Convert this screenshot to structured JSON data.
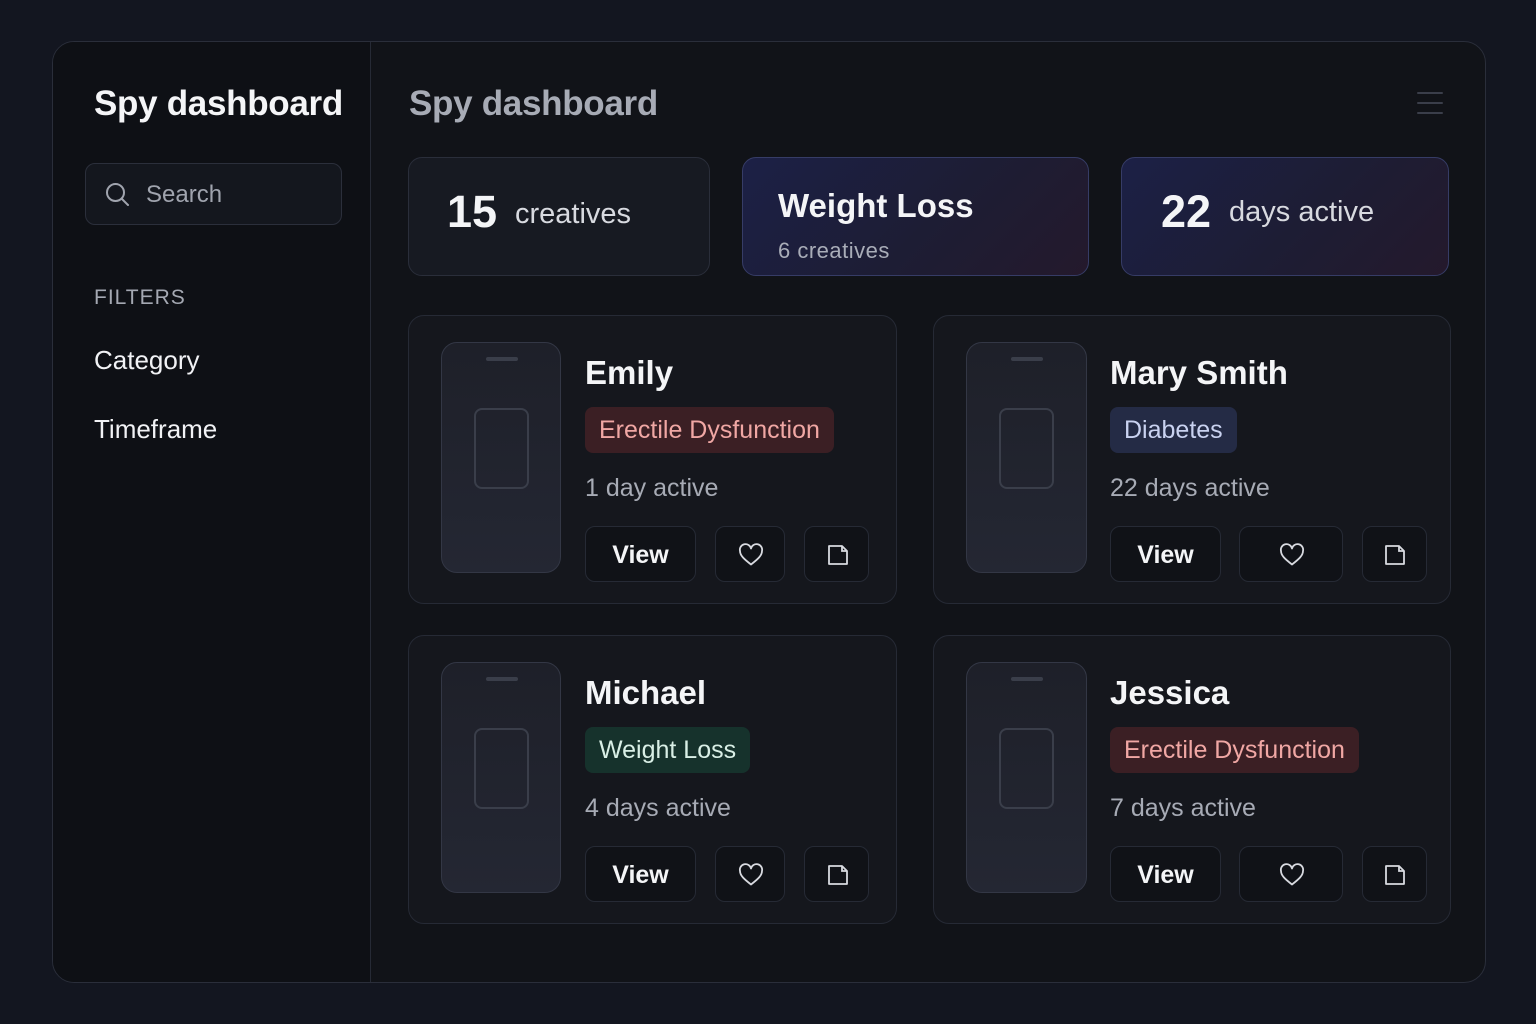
{
  "sidebar": {
    "title": "Spy dashboard",
    "search_placeholder": "Search",
    "filters_label": "FILTERS",
    "filters": [
      "Category",
      "Timeframe"
    ]
  },
  "main": {
    "title": "Spy dashboard",
    "menu_icon": "hamburger-menu-icon"
  },
  "stats": {
    "creatives": {
      "value": "15",
      "label": "creatives"
    },
    "top_category": {
      "title": "Weight Loss",
      "sub": "6 creatives"
    },
    "days": {
      "value": "22",
      "label": "days active"
    }
  },
  "cards": [
    {
      "name": "Emily",
      "category": "Erectile Dysfunction",
      "days": "1 day active",
      "view_label": "View"
    },
    {
      "name": "Mary Smith",
      "category": "Diabetes",
      "days": "22 days active",
      "view_label": "View"
    },
    {
      "name": "Michael",
      "category": "Weight Loss",
      "days": "4 days active",
      "view_label": "View"
    },
    {
      "name": "Jessica",
      "category": "Erectile Dysfunction",
      "days": "7 days active",
      "view_label": "View"
    }
  ],
  "tag_colors": {
    "Erectile Dysfunction": "#3b1f24",
    "Diabetes": "#242b45",
    "Weight Loss": "#16322c"
  },
  "icons": {
    "like": "heart-icon",
    "save": "save-icon",
    "search": "search-icon"
  }
}
